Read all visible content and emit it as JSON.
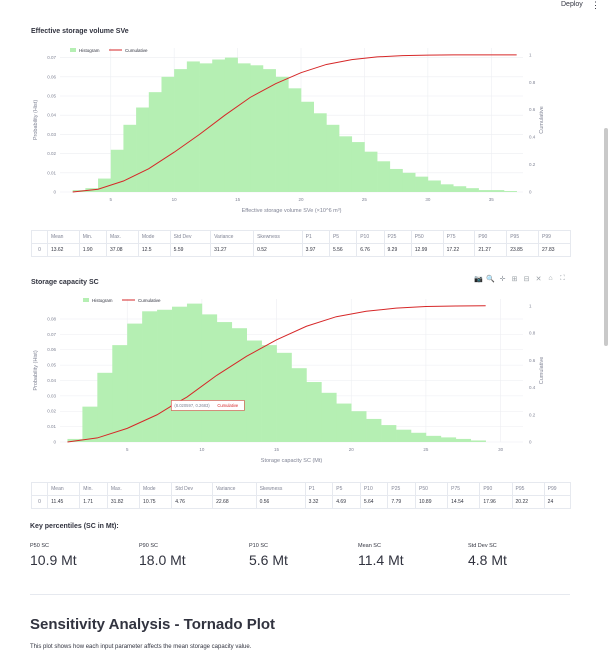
{
  "topbar": {
    "deploy_label": "Deploy",
    "menu_icon": "⋮"
  },
  "chart1": {
    "title": "Effective storage volume SVe",
    "chart_data": {
      "type": "bar",
      "xlabel": "Effective storage volume SVe (×10^6 m³)",
      "ylabel": "Probability (Hist)",
      "y2label": "Cumulative",
      "xlim": [
        1,
        37.5
      ],
      "ylim": [
        0,
        0.075
      ],
      "y2lim": [
        0,
        1.05
      ],
      "xticks": [
        5,
        10,
        15,
        20,
        25,
        30,
        35
      ],
      "yticks": [
        0,
        0.01,
        0.02,
        0.03,
        0.04,
        0.05,
        0.06,
        0.07
      ],
      "y2ticks": [
        0,
        0.2,
        0.4,
        0.6,
        0.8,
        1
      ],
      "bin_start": 2,
      "bin_width": 1,
      "series": [
        {
          "name": "Histogram",
          "values": [
            0.001,
            0.002,
            0.007,
            0.022,
            0.035,
            0.044,
            0.052,
            0.06,
            0.064,
            0.068,
            0.067,
            0.069,
            0.07,
            0.067,
            0.066,
            0.064,
            0.06,
            0.054,
            0.047,
            0.041,
            0.035,
            0.029,
            0.026,
            0.021,
            0.016,
            0.012,
            0.01,
            0.008,
            0.006,
            0.004,
            0.003,
            0.002,
            0.001,
            0.001,
            0.0005
          ]
        },
        {
          "name": "Cumulative",
          "x": [
            2,
            4,
            6,
            8,
            10,
            12,
            14,
            16,
            18,
            20,
            22,
            24,
            26,
            28,
            30,
            32,
            34,
            37
          ],
          "values": [
            0.0,
            0.02,
            0.08,
            0.17,
            0.29,
            0.42,
            0.56,
            0.69,
            0.79,
            0.87,
            0.93,
            0.965,
            0.985,
            0.994,
            0.998,
            1.0,
            1.0,
            1.0
          ]
        }
      ],
      "legend_position": "top-left",
      "grid": true
    }
  },
  "table1": {
    "headers": [
      "",
      "Mean",
      "Min.",
      "Max.",
      "Mode",
      "Std Dev",
      "Variance",
      "Skewness",
      "P1",
      "P5",
      "P10",
      "P25",
      "P50",
      "P75",
      "P90",
      "P95",
      "P99"
    ],
    "rows": [
      [
        "0",
        "13.62",
        "1.90",
        "37.08",
        "12.5",
        "5.59",
        "31.27",
        "0.52",
        "3.97",
        "5.56",
        "6.76",
        "9.29",
        "12.99",
        "17.22",
        "21.27",
        "23.85",
        "27.83"
      ]
    ]
  },
  "chart2": {
    "title": "Storage capacity SC",
    "toolbar_icons": [
      "camera-icon",
      "zoom-icon",
      "pan-icon",
      "zoom-in-icon",
      "zoom-out-icon",
      "autoscale-icon",
      "home-icon",
      "fullscreen-icon"
    ],
    "toolbar_glyphs": [
      "📷",
      "🔍",
      "✛",
      "⊞",
      "⊟",
      "✕",
      "⌂",
      "⛶"
    ],
    "tooltip_text": "(8.020597, 0.2683)",
    "tooltip_series": "Cumulative",
    "chart_data": {
      "type": "bar",
      "xlabel": "Storage capacity SC (Mt)",
      "ylabel": "Probability (Hist)",
      "y2label": "Cumulative",
      "xlim": [
        0.5,
        31.5
      ],
      "ylim": [
        0,
        0.093
      ],
      "y2lim": [
        0,
        1.05
      ],
      "xticks": [
        5,
        10,
        15,
        20,
        25,
        30
      ],
      "yticks": [
        0,
        0.01,
        0.02,
        0.03,
        0.04,
        0.05,
        0.06,
        0.07,
        0.08
      ],
      "y2ticks": [
        0,
        0.2,
        0.4,
        0.6,
        0.8,
        1
      ],
      "bin_start": 1,
      "bin_width": 1,
      "series": [
        {
          "name": "Histogram",
          "values": [
            0.002,
            0.023,
            0.045,
            0.063,
            0.077,
            0.085,
            0.086,
            0.088,
            0.09,
            0.083,
            0.078,
            0.074,
            0.066,
            0.063,
            0.058,
            0.048,
            0.039,
            0.032,
            0.025,
            0.02,
            0.015,
            0.011,
            0.008,
            0.006,
            0.004,
            0.003,
            0.002,
            0.001
          ]
        },
        {
          "name": "Cumulative",
          "x": [
            1,
            3,
            5,
            7,
            8.02,
            9,
            11,
            13,
            15,
            17,
            19,
            21,
            23,
            25,
            27,
            29
          ],
          "values": [
            0.0,
            0.03,
            0.1,
            0.2,
            0.2683,
            0.33,
            0.49,
            0.63,
            0.75,
            0.85,
            0.92,
            0.96,
            0.983,
            0.995,
            0.999,
            1.0
          ]
        }
      ],
      "legend_position": "top-left",
      "grid": true
    }
  },
  "table2": {
    "headers": [
      "",
      "Mean",
      "Min.",
      "Max.",
      "Mode",
      "Std Dev",
      "Variance",
      "Skewness",
      "P1",
      "P5",
      "P10",
      "P25",
      "P50",
      "P75",
      "P90",
      "P95",
      "P99"
    ],
    "rows": [
      [
        "0",
        "11.45",
        "1.71",
        "31.82",
        "10.75",
        "4.76",
        "22.68",
        "0.56",
        "3.32",
        "4.69",
        "5.64",
        "7.79",
        "10.89",
        "14.54",
        "17.96",
        "20.22",
        "24"
      ]
    ]
  },
  "key_percentiles": {
    "heading": "Key percentiles (SC in Mt):",
    "metrics": [
      {
        "label": "P50 SC",
        "value": "10.9 Mt"
      },
      {
        "label": "P90 SC",
        "value": "18.0 Mt"
      },
      {
        "label": "P10 SC",
        "value": "5.6 Mt"
      },
      {
        "label": "Mean SC",
        "value": "11.4 Mt"
      },
      {
        "label": "Std Dev SC",
        "value": "4.8 Mt"
      }
    ]
  },
  "sensitivity": {
    "title": "Sensitivity Analysis - Tornado Plot",
    "description": "This plot shows how each input parameter affects the mean storage capacity value."
  },
  "colors": {
    "bar": "#b5efb3",
    "line": "#d62728",
    "grid": "#eceef2",
    "text": "#31333f",
    "muted": "#808495"
  }
}
